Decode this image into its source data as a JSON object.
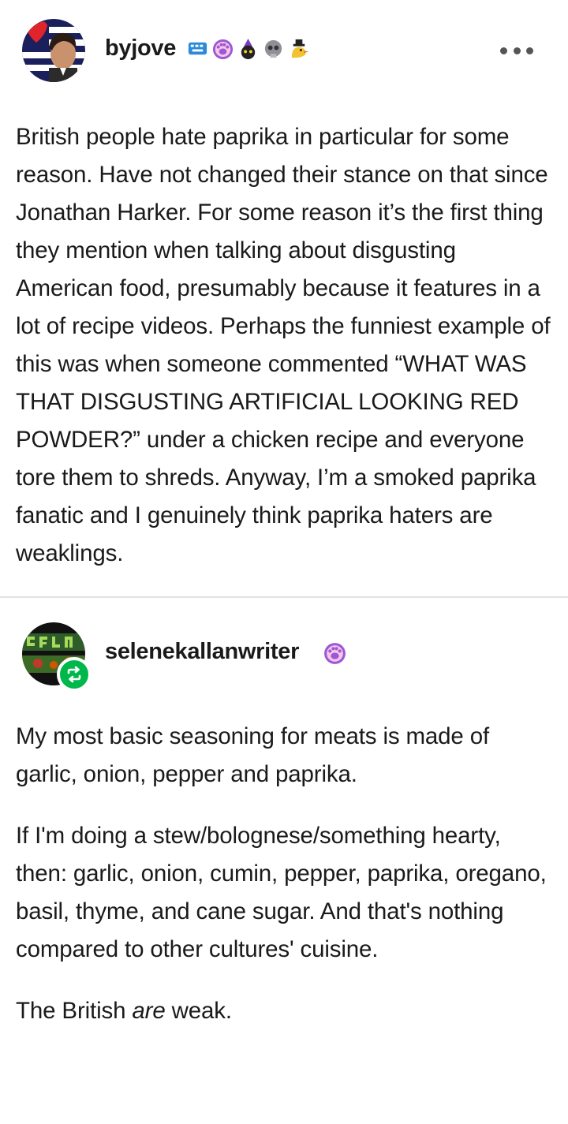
{
  "post1": {
    "username": "byjove",
    "badges": [
      "keyboard-badge-icon",
      "paw-badge-icon",
      "cat-wizard-badge-icon",
      "skull-badge-icon",
      "bird-hat-badge-icon"
    ],
    "more_label": "More options",
    "text": "British people hate paprika in particular for some reason. Have not changed their stance on that since Jonathan Harker. For some reason it’s the first thing they mention when talking about disgusting American food, presumably because it features in a lot of recipe videos. Perhaps the funniest example of this was when someone commented “WHAT WAS THAT DISGUSTING ARTIFICIAL LOOKING RED POWDER?” under a chicken recipe and everyone tore them to shreds. Anyway, I’m a smoked paprika fanatic and I genuinely think paprika haters are weaklings."
  },
  "post2": {
    "username": "selenekallanwriter",
    "badges": [
      "paw-badge-icon"
    ],
    "paragraphs": [
      "My most basic seasoning for meats is made of garlic, onion, pepper and paprika.",
      "If I'm doing a stew/bolognese/something hearty, then: garlic, onion, cumin, pepper, paprika, oregano, basil, thyme, and cane sugar. And that's nothing compared to other cultures' cuisine."
    ],
    "final": {
      "before": "The British ",
      "emphasis": "are",
      "after": " weak."
    }
  },
  "colors": {
    "reblog_green": "#00b84a",
    "text": "#1a1a1a",
    "divider": "#e3e3e3"
  }
}
